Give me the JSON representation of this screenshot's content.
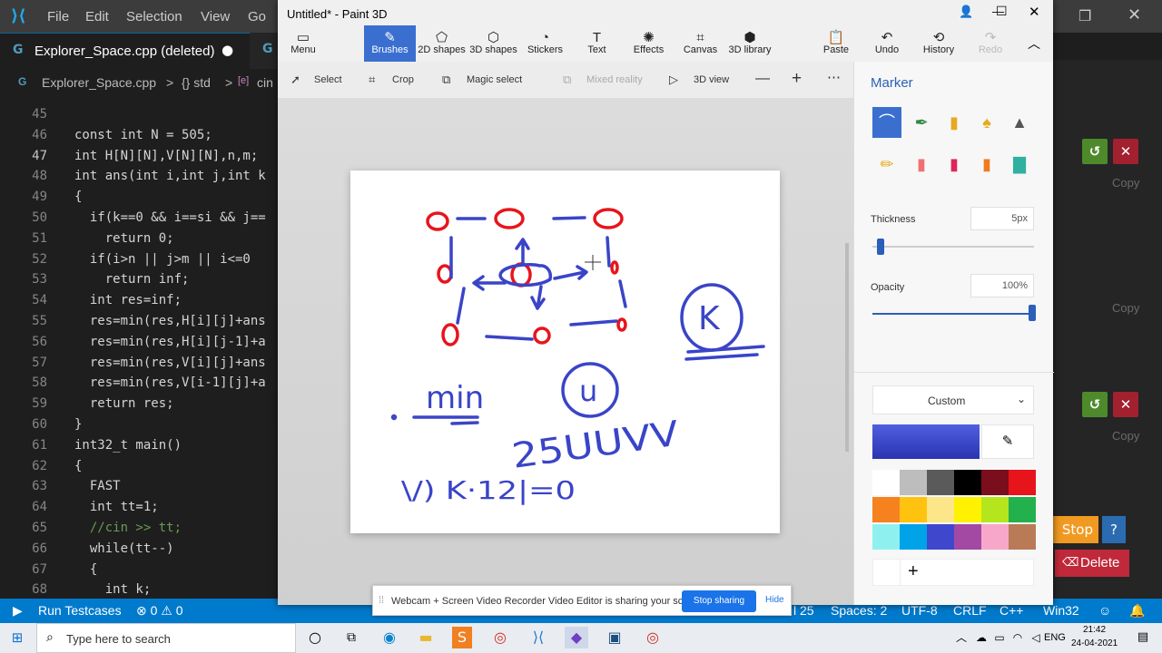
{
  "vscode": {
    "menu": [
      "File",
      "Edit",
      "Selection",
      "View",
      "Go"
    ],
    "tab_label": "Explorer_Space.cpp (deleted)",
    "tab_dot": "●",
    "breadcrumb": {
      "file": "Explorer_Space.cpp",
      "sep": ">",
      "ns": "{} std",
      "item": "cin"
    },
    "lines": [
      {
        "n": "45",
        "code": ""
      },
      {
        "n": "46",
        "code": "const int N = 505;"
      },
      {
        "n": "47",
        "code": "int H[N][N],V[N][N],n,m;"
      },
      {
        "n": "48",
        "code": "int ans(int i,int j,int k"
      },
      {
        "n": "49",
        "code": "{"
      },
      {
        "n": "50",
        "code": "  if(k==0 && i==si && j=="
      },
      {
        "n": "51",
        "code": "    return 0;"
      },
      {
        "n": "52",
        "code": "  if(i>n || j>m || i<=0"
      },
      {
        "n": "53",
        "code": "    return inf;"
      },
      {
        "n": "54",
        "code": "  int res=inf;"
      },
      {
        "n": "55",
        "code": "  res=min(res,H[i][j]+ans"
      },
      {
        "n": "56",
        "code": "  res=min(res,H[i][j-1]+a"
      },
      {
        "n": "57",
        "code": "  res=min(res,V[i][j]+ans"
      },
      {
        "n": "58",
        "code": "  res=min(res,V[i-1][j]+a"
      },
      {
        "n": "59",
        "code": "  return res;"
      },
      {
        "n": "60",
        "code": "}"
      },
      {
        "n": "61",
        "code": "int32_t main()"
      },
      {
        "n": "62",
        "code": "{"
      },
      {
        "n": "63",
        "code": "  FAST"
      },
      {
        "n": "64",
        "code": "  int tt=1;"
      },
      {
        "n": "65",
        "code": "  //cin >> tt;"
      },
      {
        "n": "66",
        "code": "  while(tt--)"
      },
      {
        "n": "67",
        "code": "  {"
      },
      {
        "n": "68",
        "code": "    int k;"
      }
    ],
    "status": {
      "run": "Run Testcases",
      "problems": "⊗ 0 ⚠ 0",
      "col": "l 25",
      "spaces": "Spaces: 2",
      "encoding": "UTF-8",
      "eol": "CRLF",
      "lang": "C++",
      "platform": "Win32"
    },
    "right_panel": {
      "copy": "Copy",
      "stop": "Stop",
      "help": "?",
      "delete": "Delete"
    }
  },
  "paint": {
    "title": "Untitled* - Paint 3D",
    "ribbon": [
      {
        "label": "Menu",
        "icon": "▭"
      },
      {
        "label": "Brushes",
        "icon": "✎"
      },
      {
        "label": "2D shapes",
        "icon": "⬠"
      },
      {
        "label": "3D shapes",
        "icon": "⬡"
      },
      {
        "label": "Stickers",
        "icon": "◔"
      },
      {
        "label": "Text",
        "icon": "T"
      },
      {
        "label": "Effects",
        "icon": "✺"
      },
      {
        "label": "Canvas",
        "icon": "⌗"
      },
      {
        "label": "3D library",
        "icon": "⬢"
      }
    ],
    "ribbon_right": [
      {
        "label": "Paste",
        "icon": "📋"
      },
      {
        "label": "Undo",
        "icon": "↶"
      },
      {
        "label": "History",
        "icon": "⟲"
      },
      {
        "label": "Redo",
        "icon": "↷"
      }
    ],
    "toolbar": {
      "select": "Select",
      "crop": "Crop",
      "magic": "Magic select",
      "mixed": "Mixed reality",
      "view3d": "3D view"
    },
    "side": {
      "title": "Marker",
      "thickness_label": "Thickness",
      "thickness_value": "5px",
      "thickness": 0.05,
      "opacity_label": "Opacity",
      "opacity_value": "100%",
      "opacity": 1.0,
      "color_mode": "Custom",
      "current_color": "#3a44c8",
      "add": "+"
    },
    "palette": [
      "#ffffff",
      "#bdbdbd",
      "#5a5a5a",
      "#000000",
      "#7a0e1c",
      "#e8141c",
      "#f5821f",
      "#ffc20e",
      "#fde68a",
      "#fff200",
      "#b5e61d",
      "#22b14c",
      "#8ff1ef",
      "#00a2e8",
      "#3f48cc",
      "#a349a4",
      "#f7a8c8",
      "#b97a57"
    ],
    "canvas_text": {
      "min": "min",
      "number": "25UUVV",
      "bottom": "\\/) K·12|=0",
      "circled_k": "K",
      "circled_u": "u"
    }
  },
  "share": {
    "message": "Webcam + Screen Video Recorder Video Editor is sharing your screen.",
    "stop": "Stop sharing",
    "hide": "Hide"
  },
  "taskbar": {
    "search_placeholder": "Type here to search",
    "lang": "ENG",
    "time": "21:42",
    "date": "24-04-2021"
  }
}
